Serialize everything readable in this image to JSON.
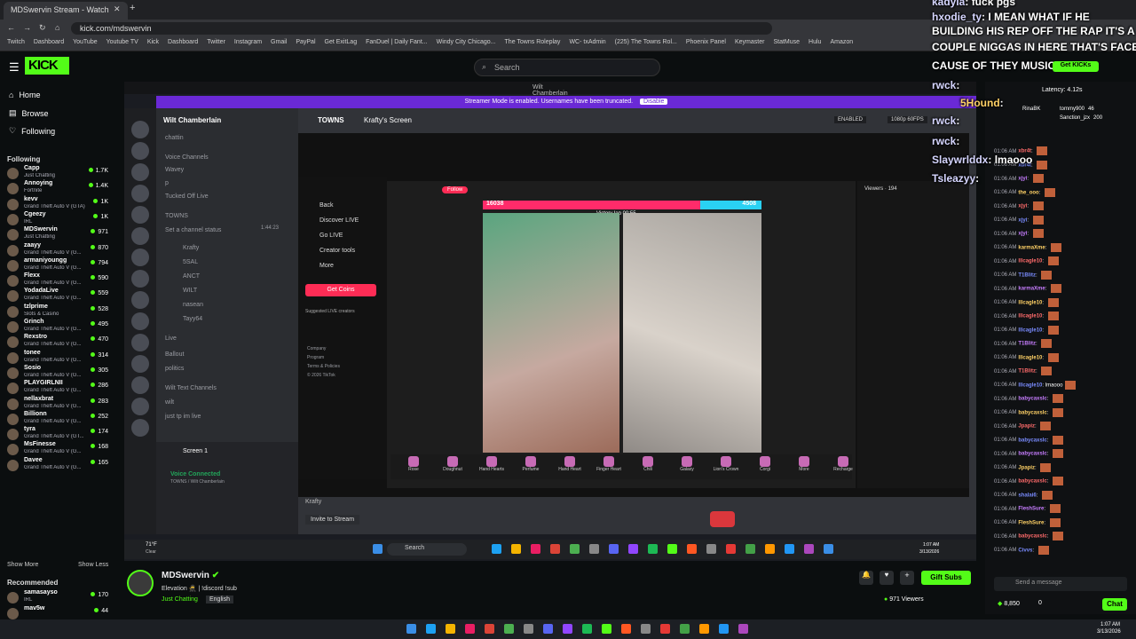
{
  "browser": {
    "tabs": [
      "MDSwervin Stream - Watch"
    ],
    "url": "kick.com/mdswervin",
    "bookmarks": [
      "Twitch",
      "Dashboard",
      "YouTube",
      "Youtube TV",
      "Kick",
      "Dashboard",
      "Twitter",
      "Instagram",
      "Gmail",
      "PayPal",
      "Get ExitLag",
      "FanDuel | Daily Fant...",
      "Windy City Chicago...",
      "The Towns Roleplay",
      "WC- txAdmin",
      "(225) The Towns Rol...",
      "Phoenix Panel",
      "Keymaster",
      "StatMuse",
      "Hulu",
      "Amazon"
    ]
  },
  "kick": {
    "logo": "KICK",
    "search_placeholder": "Search",
    "nav": [
      {
        "label": "Home",
        "icon": "home-icon"
      },
      {
        "label": "Browse",
        "icon": "browse-icon"
      },
      {
        "label": "Following",
        "icon": "heart-icon"
      }
    ],
    "following_title": "Following",
    "following": [
      {
        "name": "Capp",
        "game": "Just Chatting",
        "count": "1.7K"
      },
      {
        "name": "Annoying",
        "game": "Fortnite",
        "count": "1.4K"
      },
      {
        "name": "kevv",
        "game": "Grand Theft Auto V (GTA)",
        "count": "1K"
      },
      {
        "name": "Cgeezy",
        "game": "IRL",
        "count": "1K"
      },
      {
        "name": "MDSwervin",
        "game": "Just Chatting",
        "count": "971"
      },
      {
        "name": "zaayy",
        "game": "Grand Theft Auto V (G...",
        "count": "870"
      },
      {
        "name": "armaniyoungg",
        "game": "Grand Theft Auto V (G...",
        "count": "794"
      },
      {
        "name": "Flexx",
        "game": "Grand Theft Auto V (G...",
        "count": "590"
      },
      {
        "name": "YodadaLive",
        "game": "Grand Theft Auto V (G...",
        "count": "559"
      },
      {
        "name": "tzlprime",
        "game": "Slots & Casino",
        "count": "528"
      },
      {
        "name": "Grinch",
        "game": "Grand Theft Auto V (G...",
        "count": "495"
      },
      {
        "name": "Rexstro",
        "game": "Grand Theft Auto V (G...",
        "count": "470"
      },
      {
        "name": "tonee",
        "game": "Grand Theft Auto V (G...",
        "count": "314"
      },
      {
        "name": "Sosio",
        "game": "Grand Theft Auto V (G...",
        "count": "305"
      },
      {
        "name": "PLAYGIRLNII",
        "game": "Grand Theft Auto V (G...",
        "count": "286"
      },
      {
        "name": "nellaxbrat",
        "game": "Grand Theft Auto V (G...",
        "count": "283"
      },
      {
        "name": "Billionn",
        "game": "Grand Theft Auto V (G...",
        "count": "252"
      },
      {
        "name": "tyra",
        "game": "Grand Theft Auto V (GT...",
        "count": "174"
      },
      {
        "name": "MsFinesse",
        "game": "Grand Theft Auto V (G...",
        "count": "168"
      },
      {
        "name": "Davee",
        "game": "Grand Theft Auto V (G...",
        "count": "165"
      }
    ],
    "show_more": "Show More",
    "show_less": "Show Less",
    "recommended_title": "Recommended",
    "recommended": [
      {
        "name": "samasayso",
        "game": "IRL",
        "count": "170"
      },
      {
        "name": "mav5w",
        "game": "",
        "count": "44"
      }
    ]
  },
  "player": {
    "window_title": "Wilt Chamberlain",
    "streamer_mode": "Streamer Mode is enabled. Usernames have been truncated.",
    "disable": "Disable",
    "discord": {
      "server": "Wilt Chamberlain",
      "channels": [
        "chattin",
        "Voice Channels",
        "Wavey",
        "p",
        "Tucked Off Live",
        "TOWNS",
        "Set a channel status",
        "Krafty",
        "5SAL",
        "ANCT",
        "WILT",
        "nasean",
        "Tayy64",
        "Live",
        "Ballout",
        "politics",
        "Wilt Text Channels",
        "wilt",
        "just tp im live"
      ],
      "towns_time": "1:44:23",
      "header": "TOWNS",
      "screen_label": "Krafty's Screen",
      "enabled": "ENABLED",
      "quality": "1080p 60FPS",
      "screen1": "Screen 1",
      "voice_connected": "Voice Connected",
      "voice_channel": "TOWNS / Wilt Chamberlain",
      "invite": "Invite to Stream",
      "krafty": "Krafty"
    },
    "tiktok": {
      "nav": [
        "Back",
        "Discover LIVE",
        "Go LIVE",
        "Creator tools",
        "More"
      ],
      "get_coins": "Get Coins",
      "suggested": "Suggested LIVE creators",
      "footer": [
        "Company",
        "Program",
        "Terms & Policies",
        "© 2026 TikTok"
      ],
      "follow": "Follow",
      "score_left": "16038",
      "score_right": "4508",
      "round": "Victory lap 00:55",
      "viewers_title": "Viewers · 194",
      "gifts": [
        "Rose",
        "Doughnut",
        "Hand Hearts",
        "Perfume",
        "Hand Heart",
        "Finger Heart",
        "Chili",
        "Galaxy",
        "Lion's Crown",
        "Corgi",
        "More",
        "Recharge"
      ]
    },
    "weather": "71°F",
    "weather_sub": "Clear",
    "taskbar_search": "Search",
    "clock": "1:07 AM",
    "date": "3/13/2026"
  },
  "stream_info": {
    "name": "MDSwervin",
    "title": "Elevation 🥷 | !discord !sub",
    "category": "Just Chatting",
    "language": "English",
    "viewers": "971 Viewers",
    "gift_subs": "Gift Subs"
  },
  "chat": {
    "overlay": [
      {
        "user": "kadyla",
        "text": ": fuck pgs"
      },
      {
        "user": "hxodie_ty",
        "text": ": I MEAN WHAT IF HE"
      },
      {
        "user": "",
        "text": "BUILDING HIS REP OFF THE RAP IT'S A"
      },
      {
        "user": "",
        "text": "COUPLE NIGGAS IN HERE THAT'S FACES"
      },
      {
        "user": "",
        "text": "CAUSE OF THEY MUSIC"
      },
      {
        "user": "rwck",
        "text": ":"
      },
      {
        "user": "5Hound",
        "text": ":"
      },
      {
        "user": "rwck",
        "text": ":"
      },
      {
        "user": "rwck",
        "text": ":"
      },
      {
        "user": "Slaywrlddx",
        "text": ": lmaooo"
      },
      {
        "user": "Tsleazyy",
        "text": ":"
      }
    ],
    "get_kicks": "Get KICKs",
    "latency": "Latency: 4.12s",
    "leaders": [
      {
        "name": "RinaBK",
        "n": ""
      },
      {
        "name": "tommy900",
        "n": "46"
      },
      {
        "name": "Sanction_jzx",
        "n": "200"
      }
    ],
    "messages": [
      {
        "t": "01:06 AM",
        "u": "xbr4t",
        "m": ""
      },
      {
        "t": "01:06 AM",
        "u": "xbr4t",
        "m": ""
      },
      {
        "t": "01:06 AM",
        "u": "xjyi",
        "m": ""
      },
      {
        "t": "01:06 AM",
        "u": "the_ooo",
        "m": ""
      },
      {
        "t": "01:06 AM",
        "u": "xjyi",
        "m": ""
      },
      {
        "t": "01:06 AM",
        "u": "xjyi",
        "m": ""
      },
      {
        "t": "01:06 AM",
        "u": "xjyi",
        "m": ""
      },
      {
        "t": "01:06 AM",
        "u": "karmaXme",
        "m": ""
      },
      {
        "t": "01:06 AM",
        "u": "lllcagle10",
        "m": ""
      },
      {
        "t": "01:06 AM",
        "u": "T1Blitz",
        "m": ""
      },
      {
        "t": "01:06 AM",
        "u": "karmaXme",
        "m": ""
      },
      {
        "t": "01:06 AM",
        "u": "lllcagle10",
        "m": ""
      },
      {
        "t": "01:06 AM",
        "u": "lllcagle10",
        "m": ""
      },
      {
        "t": "01:06 AM",
        "u": "lllcagle10",
        "m": ""
      },
      {
        "t": "01:06 AM",
        "u": "T1Blitz",
        "m": ""
      },
      {
        "t": "01:06 AM",
        "u": "lllcagle10",
        "m": ""
      },
      {
        "t": "01:06 AM",
        "u": "T1Blitz",
        "m": ""
      },
      {
        "t": "01:06 AM",
        "u": "lllcagle10",
        "m": "lmaooo"
      },
      {
        "t": "01:06 AM",
        "u": "babycaxslc",
        "m": ""
      },
      {
        "t": "01:06 AM",
        "u": "babycaxslc",
        "m": ""
      },
      {
        "t": "01:06 AM",
        "u": "Jpapiz",
        "m": ""
      },
      {
        "t": "01:06 AM",
        "u": "babycaxslc",
        "m": ""
      },
      {
        "t": "01:06 AM",
        "u": "babycaxslc",
        "m": ""
      },
      {
        "t": "01:06 AM",
        "u": "Jpapiz",
        "m": ""
      },
      {
        "t": "01:06 AM",
        "u": "babycaxslc",
        "m": ""
      },
      {
        "t": "01:06 AM",
        "u": "shalai6",
        "m": ""
      },
      {
        "t": "01:06 AM",
        "u": "FleshSure",
        "m": ""
      },
      {
        "t": "01:06 AM",
        "u": "FleshSure",
        "m": ""
      },
      {
        "t": "01:06 AM",
        "u": "babycaxslc",
        "m": ""
      },
      {
        "t": "01:06 AM",
        "u": "Civvs",
        "m": ""
      }
    ],
    "send_placeholder": "Send a message",
    "points": "8,850",
    "zero": "0",
    "chat_btn": "Chat"
  },
  "os": {
    "clock": "1:07 AM",
    "date": "3/13/2026"
  }
}
